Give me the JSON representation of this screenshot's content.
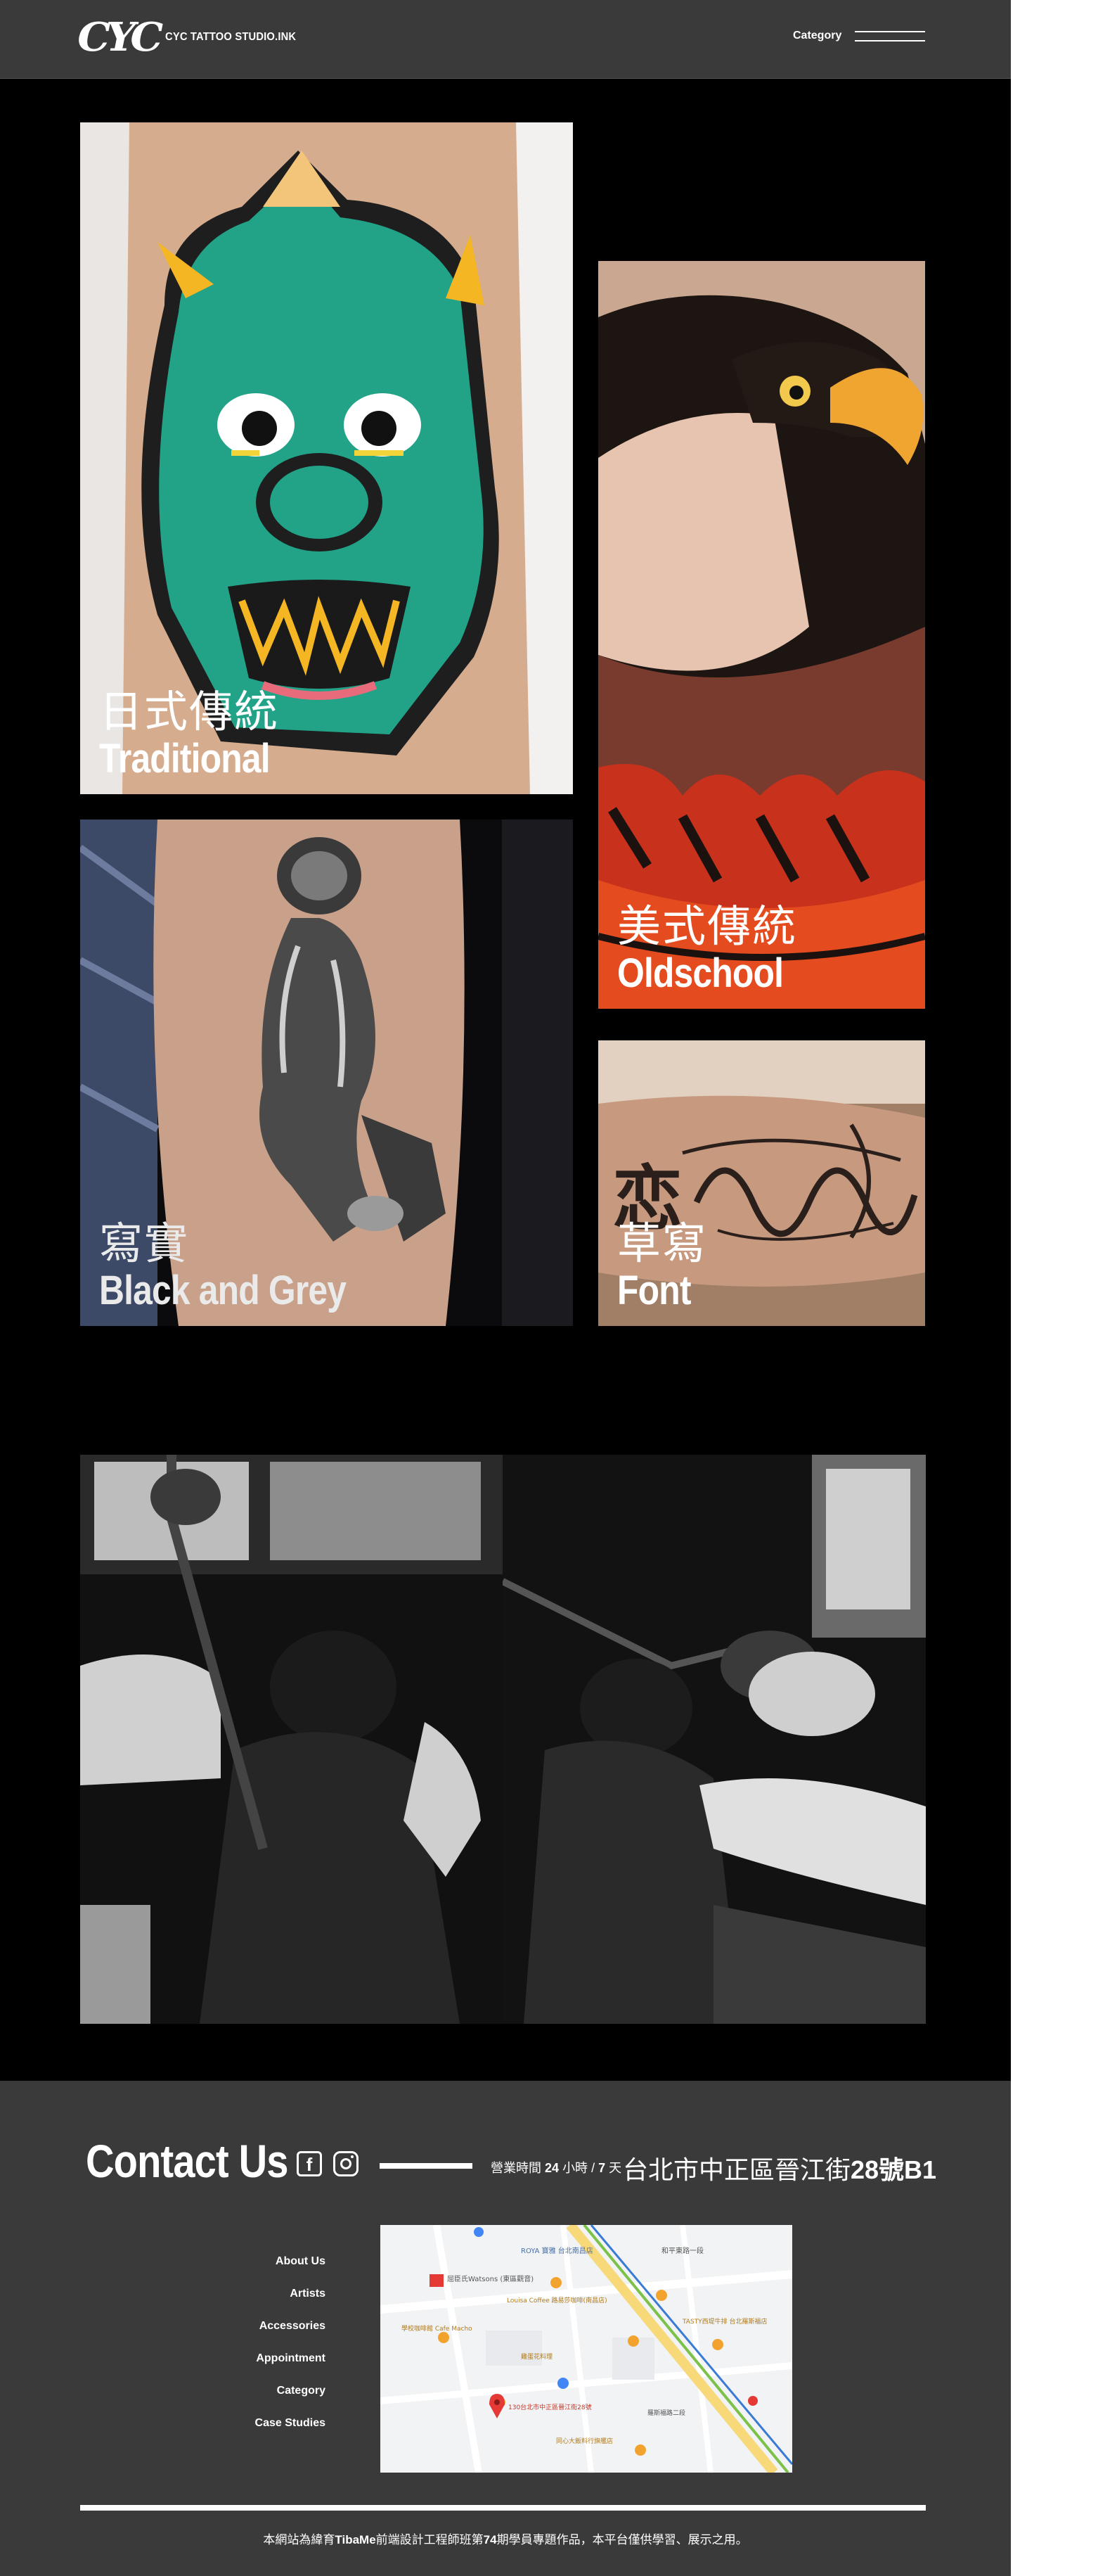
{
  "header": {
    "logo_mark": "CYC",
    "logo_text": "CYC TATTOO STUDIO.INK",
    "nav_label": "Category"
  },
  "styles": [
    {
      "zh": "日式傳統",
      "en": "Traditional"
    },
    {
      "zh": "美式傳統",
      "en": "Oldschool"
    },
    {
      "zh": "寫實",
      "en": "Black and Grey"
    },
    {
      "zh": "草寫",
      "en": "Font"
    }
  ],
  "footer": {
    "contact_title": "Contact Us",
    "hours_prefix": "營業時間",
    "hours_h": "24",
    "hours_mid": "小時 /",
    "hours_d": "7",
    "hours_suffix": "天",
    "address_prefix": "台北市中正區晉江街",
    "address_num": "28號B1",
    "nav": [
      "About Us",
      "Artists",
      "Accessories",
      "Appointment",
      "Category",
      "Case Studies"
    ],
    "copyright_a": "本網站為緯育",
    "copyright_b": "TibaMe",
    "copyright_c": "前端設計工程師班第",
    "copyright_d": "74",
    "copyright_e": "期學員專題作品，本平台僅供學習、展示之用。"
  },
  "map": {
    "labels": [
      "ROYA 寶雅 台北南昌店",
      "和平東路一段",
      "屈臣氏Watsons (東區觀音)",
      "Louisa Coffee 路易莎咖啡(南昌店)",
      "學校咖啡館 Cafe Macho",
      "TASTY西堤牛排 台北羅斯福店",
      "雞蛋花料理",
      "130台北市中正區晉江街28號",
      "羅斯福路二段",
      "同心大飯料行旗艦店"
    ]
  },
  "colors": {
    "header_bg": "#3b3a3b",
    "page_bg": "#000000",
    "footer_bg": "#3b3a3b",
    "map_pin": "#e53935"
  }
}
